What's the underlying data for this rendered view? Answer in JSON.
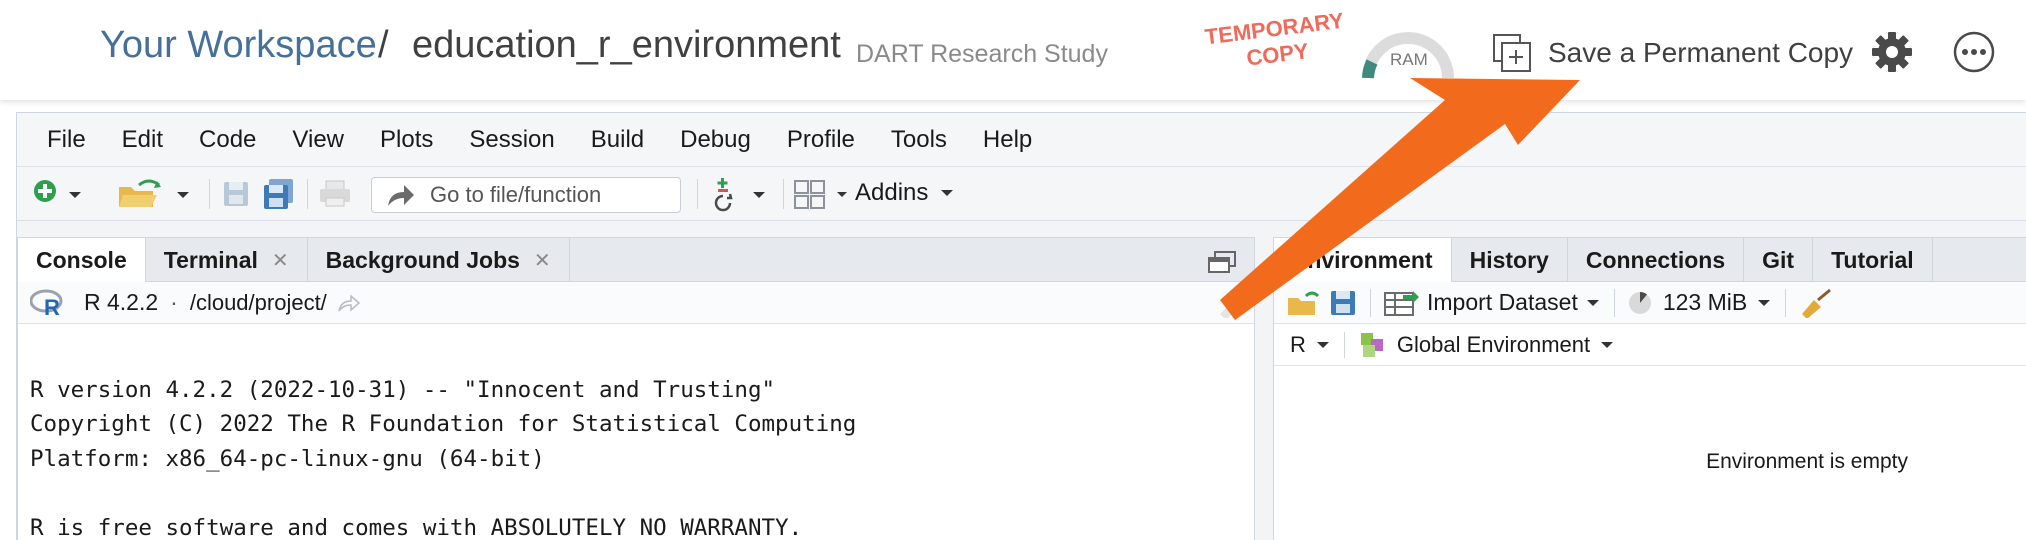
{
  "header": {
    "workspace_link": "Your Workspace",
    "separator": "/",
    "project_name": "education_r_environment",
    "project_subtitle": "DART Research Study",
    "temporary_badge": "TEMPORARY\nCOPY",
    "ram_label": "RAM",
    "save_copy_label": "Save a Permanent Copy",
    "settings_icon": "gear-icon",
    "more_icon": "ellipsis-circle-icon",
    "accent_color": "#447099",
    "badge_color": "#f06a5b"
  },
  "menu": [
    "File",
    "Edit",
    "Code",
    "View",
    "Plots",
    "Session",
    "Build",
    "Debug",
    "Profile",
    "Tools",
    "Help"
  ],
  "toolbar": {
    "goto_placeholder": "Go to file/function",
    "addins_label": "Addins"
  },
  "left_pane": {
    "tabs": [
      {
        "label": "Console",
        "closable": false
      },
      {
        "label": "Terminal",
        "closable": true
      },
      {
        "label": "Background Jobs",
        "closable": true
      }
    ],
    "r_version": "R 4.2.2",
    "dot": "·",
    "path": "/cloud/project/",
    "console_lines": [
      "",
      "R version 4.2.2 (2022-10-31) -- \"Innocent and Trusting\"",
      "Copyright (C) 2022 The R Foundation for Statistical Computing",
      "Platform: x86_64-pc-linux-gnu (64-bit)",
      "",
      "R is free software and comes with ABSOLUTELY NO WARRANTY."
    ]
  },
  "right_pane": {
    "tabs": [
      {
        "label": "Environment"
      },
      {
        "label": "History"
      },
      {
        "label": "Connections"
      },
      {
        "label": "Git"
      },
      {
        "label": "Tutorial"
      }
    ],
    "import_dataset": "Import Dataset",
    "memory": "123 MiB",
    "language": "R",
    "scope": "Global Environment",
    "empty_message": "Environment is empty"
  },
  "annotation_arrow_color": "#f26b1d"
}
